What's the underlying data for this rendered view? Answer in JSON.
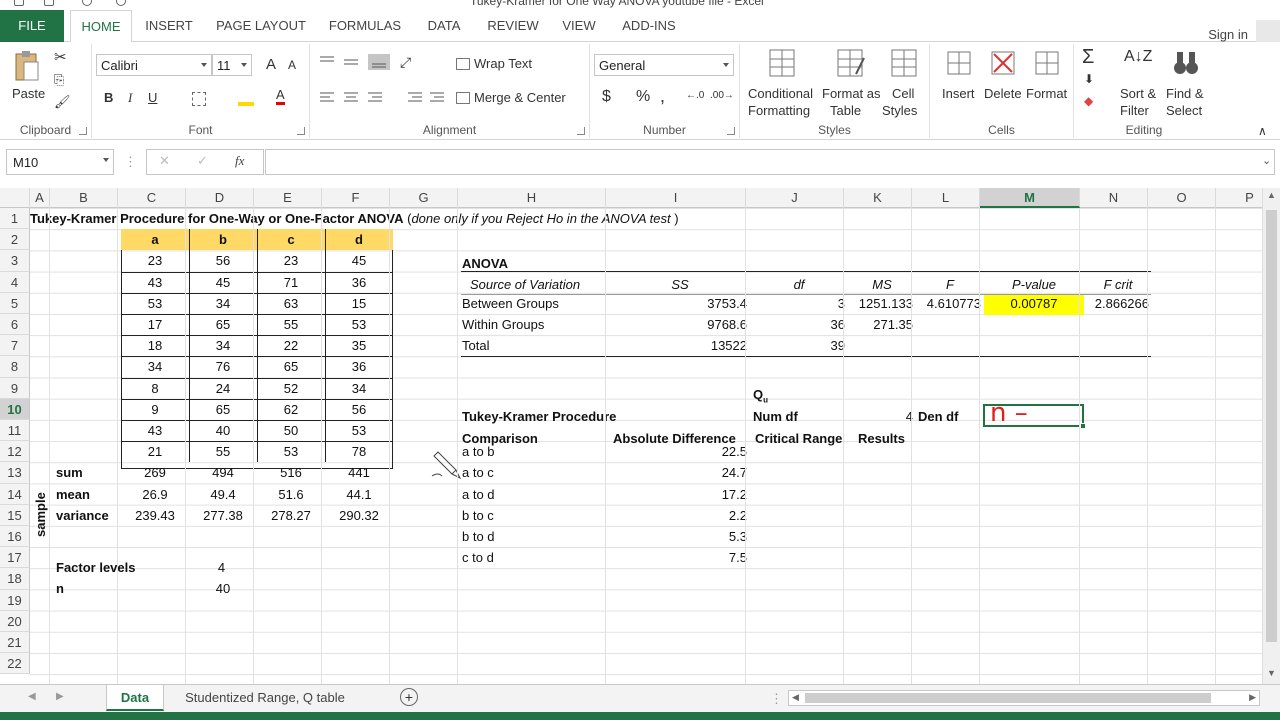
{
  "window": {
    "title": "Tukey-Kramer for One Way ANOVA youtube file - Excel"
  },
  "tabs": {
    "file": "FILE",
    "items": [
      "HOME",
      "INSERT",
      "PAGE LAYOUT",
      "FORMULAS",
      "DATA",
      "REVIEW",
      "VIEW",
      "ADD-INS"
    ],
    "active": "HOME"
  },
  "signin": "Sign in",
  "ribbon": {
    "clipboard": {
      "label": "Clipboard",
      "paste": "Paste"
    },
    "font": {
      "label": "Font",
      "family": "Calibri",
      "size": "11",
      "bold": "B",
      "italic": "I",
      "underline": "U",
      "grow": "A",
      "shrink": "A",
      "color": "A"
    },
    "alignment": {
      "label": "Alignment",
      "wrap": "Wrap Text",
      "merge": "Merge & Center"
    },
    "number": {
      "label": "Number",
      "format": "General",
      "currency": "$",
      "percent": "%",
      "comma": ","
    },
    "styles": {
      "label": "Styles",
      "conditional": "Conditional",
      "conditional2": "Formatting",
      "format_as": "Format as",
      "format_as2": "Table",
      "cell": "Cell",
      "cell2": "Styles"
    },
    "cells": {
      "label": "Cells",
      "insert": "Insert",
      "delete": "Delete",
      "format": "Format"
    },
    "editing": {
      "label": "Editing",
      "sort": "Sort &",
      "sort2": "Filter",
      "find": "Find &",
      "find2": "Select"
    }
  },
  "formula_bar": {
    "name_box": "M10",
    "fx": "fx",
    "value": ""
  },
  "columns": [
    "A",
    "B",
    "C",
    "D",
    "E",
    "F",
    "G",
    "H",
    "I",
    "J",
    "K",
    "L",
    "M",
    "N",
    "O",
    "P"
  ],
  "selected_column": "M",
  "rows": [
    "1",
    "2",
    "3",
    "4",
    "5",
    "6",
    "7",
    "8",
    "9",
    "10",
    "11",
    "12",
    "13",
    "14",
    "15",
    "16",
    "17",
    "18",
    "19",
    "20",
    "21",
    "22"
  ],
  "selected_row": "10",
  "sheet": {
    "title_bold": "Tukey-Kramer Procedure for One-Way or One-Factor ANOVA",
    "title_italic_pre": "(",
    "title_italic": "done only if you Reject Ho in the ANOVA test",
    "title_italic_post": ")",
    "groups": [
      "a",
      "b",
      "c",
      "d"
    ],
    "data": [
      [
        "23",
        "56",
        "23",
        "45"
      ],
      [
        "43",
        "45",
        "71",
        "36"
      ],
      [
        "53",
        "34",
        "63",
        "15"
      ],
      [
        "17",
        "65",
        "55",
        "53"
      ],
      [
        "18",
        "34",
        "22",
        "35"
      ],
      [
        "34",
        "76",
        "65",
        "36"
      ],
      [
        "8",
        "24",
        "52",
        "34"
      ],
      [
        "9",
        "65",
        "62",
        "56"
      ],
      [
        "43",
        "40",
        "50",
        "53"
      ],
      [
        "21",
        "55",
        "53",
        "78"
      ]
    ],
    "sample_label": "sample",
    "stats": [
      {
        "label": "sum",
        "values": [
          "269",
          "494",
          "516",
          "441"
        ]
      },
      {
        "label": "mean",
        "values": [
          "26.9",
          "49.4",
          "51.6",
          "44.1"
        ]
      },
      {
        "label": "variance",
        "values": [
          "239.43",
          "277.38",
          "278.27",
          "290.32"
        ]
      }
    ],
    "factor_levels_label": "Factor levels",
    "factor_levels": "4",
    "n_label": "n",
    "n": "40",
    "anova": {
      "title": "ANOVA",
      "headers": [
        "Source of Variation",
        "SS",
        "df",
        "MS",
        "F",
        "P-value",
        "F crit"
      ],
      "rows": [
        {
          "source": "Between Groups",
          "ss": "3753.4",
          "df": "3",
          "ms": "1251.133",
          "f": "4.610773",
          "p": "0.00787",
          "fcrit": "2.866266"
        },
        {
          "source": "Within Groups",
          "ss": "9768.6",
          "df": "36",
          "ms": "271.35",
          "f": "",
          "p": "",
          "fcrit": ""
        },
        {
          "source": "Total",
          "ss": "13522",
          "df": "39",
          "ms": "",
          "f": "",
          "p": "",
          "fcrit": ""
        }
      ]
    },
    "qu_label": "Q",
    "qu_sub": "u",
    "tukey": {
      "title": "Tukey-Kramer Procedure",
      "num_df_label": "Num df",
      "num_df": "4",
      "den_df_label": "Den df",
      "headers": [
        "Comparison",
        "Absolute Difference",
        "Critical Range",
        "Results"
      ],
      "rows": [
        {
          "cmp": "a to b",
          "diff": "22.5"
        },
        {
          "cmp": "a to c",
          "diff": "24.7"
        },
        {
          "cmp": "a to d",
          "diff": "17.2"
        },
        {
          "cmp": "b to c",
          "diff": "2.2"
        },
        {
          "cmp": "b to d",
          "diff": "5.3"
        },
        {
          "cmp": "c to d",
          "diff": "7.5"
        }
      ]
    },
    "annotation": "n –"
  },
  "sheet_tabs": [
    "Data",
    "Studentized Range, Q table"
  ],
  "active_sheet": "Data",
  "colors": {
    "excel_green": "#217346",
    "header_fill": "#FFD966",
    "highlight": "#FFFF00",
    "annotation": "#E0201B"
  }
}
